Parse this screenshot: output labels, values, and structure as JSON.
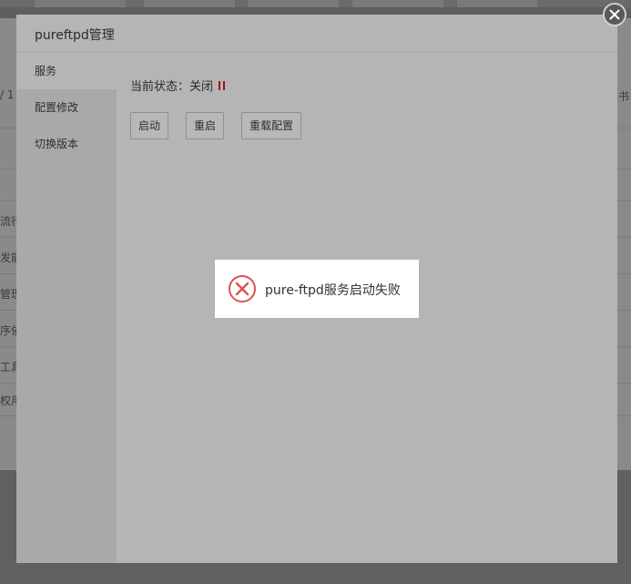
{
  "background": {
    "row_fragments": [
      "/ 1",
      "流行",
      "发能",
      "管理",
      "序依",
      "工具",
      "权用"
    ],
    "right_fragment": "书"
  },
  "dialog": {
    "title": "pureftpd管理",
    "close_icon": "close-icon",
    "sidebar": {
      "items": [
        {
          "label": "服务",
          "active": true
        },
        {
          "label": "配置修改",
          "active": false
        },
        {
          "label": "切换版本",
          "active": false
        }
      ]
    },
    "main": {
      "status_label": "当前状态：",
      "status_value": "关闭",
      "status_icon": "pause-icon",
      "status_icon_color": "#a01010",
      "buttons": {
        "start": "启动",
        "restart": "重启",
        "reload": "重载配置"
      }
    }
  },
  "toast": {
    "icon": "error-circle-icon",
    "icon_color": "#d9534f",
    "message": "pure-ftpd服务启动失败"
  }
}
